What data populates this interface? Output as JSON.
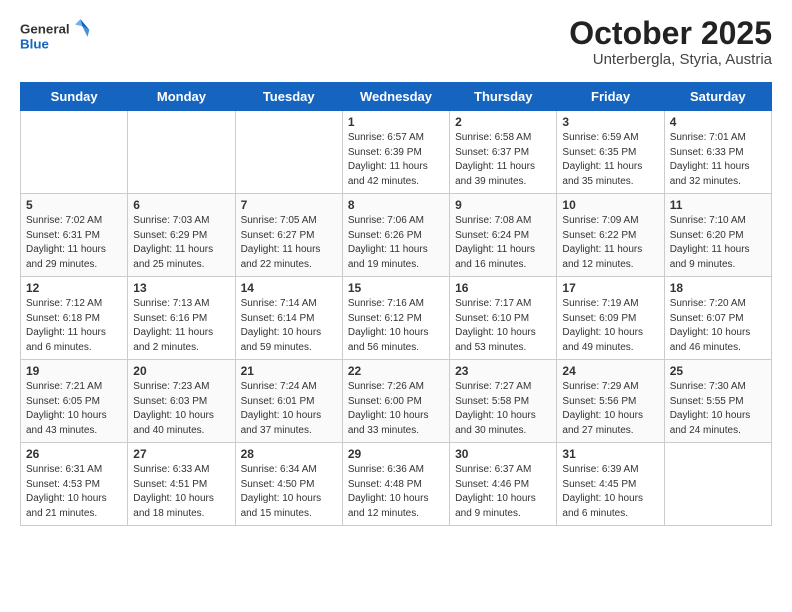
{
  "header": {
    "logo_line1": "General",
    "logo_line2": "Blue",
    "title": "October 2025",
    "subtitle": "Unterbergla, Styria, Austria"
  },
  "days_of_week": [
    "Sunday",
    "Monday",
    "Tuesday",
    "Wednesday",
    "Thursday",
    "Friday",
    "Saturday"
  ],
  "weeks": [
    [
      {
        "day": "",
        "info": ""
      },
      {
        "day": "",
        "info": ""
      },
      {
        "day": "",
        "info": ""
      },
      {
        "day": "1",
        "info": "Sunrise: 6:57 AM\nSunset: 6:39 PM\nDaylight: 11 hours and 42 minutes."
      },
      {
        "day": "2",
        "info": "Sunrise: 6:58 AM\nSunset: 6:37 PM\nDaylight: 11 hours and 39 minutes."
      },
      {
        "day": "3",
        "info": "Sunrise: 6:59 AM\nSunset: 6:35 PM\nDaylight: 11 hours and 35 minutes."
      },
      {
        "day": "4",
        "info": "Sunrise: 7:01 AM\nSunset: 6:33 PM\nDaylight: 11 hours and 32 minutes."
      }
    ],
    [
      {
        "day": "5",
        "info": "Sunrise: 7:02 AM\nSunset: 6:31 PM\nDaylight: 11 hours and 29 minutes."
      },
      {
        "day": "6",
        "info": "Sunrise: 7:03 AM\nSunset: 6:29 PM\nDaylight: 11 hours and 25 minutes."
      },
      {
        "day": "7",
        "info": "Sunrise: 7:05 AM\nSunset: 6:27 PM\nDaylight: 11 hours and 22 minutes."
      },
      {
        "day": "8",
        "info": "Sunrise: 7:06 AM\nSunset: 6:26 PM\nDaylight: 11 hours and 19 minutes."
      },
      {
        "day": "9",
        "info": "Sunrise: 7:08 AM\nSunset: 6:24 PM\nDaylight: 11 hours and 16 minutes."
      },
      {
        "day": "10",
        "info": "Sunrise: 7:09 AM\nSunset: 6:22 PM\nDaylight: 11 hours and 12 minutes."
      },
      {
        "day": "11",
        "info": "Sunrise: 7:10 AM\nSunset: 6:20 PM\nDaylight: 11 hours and 9 minutes."
      }
    ],
    [
      {
        "day": "12",
        "info": "Sunrise: 7:12 AM\nSunset: 6:18 PM\nDaylight: 11 hours and 6 minutes."
      },
      {
        "day": "13",
        "info": "Sunrise: 7:13 AM\nSunset: 6:16 PM\nDaylight: 11 hours and 2 minutes."
      },
      {
        "day": "14",
        "info": "Sunrise: 7:14 AM\nSunset: 6:14 PM\nDaylight: 10 hours and 59 minutes."
      },
      {
        "day": "15",
        "info": "Sunrise: 7:16 AM\nSunset: 6:12 PM\nDaylight: 10 hours and 56 minutes."
      },
      {
        "day": "16",
        "info": "Sunrise: 7:17 AM\nSunset: 6:10 PM\nDaylight: 10 hours and 53 minutes."
      },
      {
        "day": "17",
        "info": "Sunrise: 7:19 AM\nSunset: 6:09 PM\nDaylight: 10 hours and 49 minutes."
      },
      {
        "day": "18",
        "info": "Sunrise: 7:20 AM\nSunset: 6:07 PM\nDaylight: 10 hours and 46 minutes."
      }
    ],
    [
      {
        "day": "19",
        "info": "Sunrise: 7:21 AM\nSunset: 6:05 PM\nDaylight: 10 hours and 43 minutes."
      },
      {
        "day": "20",
        "info": "Sunrise: 7:23 AM\nSunset: 6:03 PM\nDaylight: 10 hours and 40 minutes."
      },
      {
        "day": "21",
        "info": "Sunrise: 7:24 AM\nSunset: 6:01 PM\nDaylight: 10 hours and 37 minutes."
      },
      {
        "day": "22",
        "info": "Sunrise: 7:26 AM\nSunset: 6:00 PM\nDaylight: 10 hours and 33 minutes."
      },
      {
        "day": "23",
        "info": "Sunrise: 7:27 AM\nSunset: 5:58 PM\nDaylight: 10 hours and 30 minutes."
      },
      {
        "day": "24",
        "info": "Sunrise: 7:29 AM\nSunset: 5:56 PM\nDaylight: 10 hours and 27 minutes."
      },
      {
        "day": "25",
        "info": "Sunrise: 7:30 AM\nSunset: 5:55 PM\nDaylight: 10 hours and 24 minutes."
      }
    ],
    [
      {
        "day": "26",
        "info": "Sunrise: 6:31 AM\nSunset: 4:53 PM\nDaylight: 10 hours and 21 minutes."
      },
      {
        "day": "27",
        "info": "Sunrise: 6:33 AM\nSunset: 4:51 PM\nDaylight: 10 hours and 18 minutes."
      },
      {
        "day": "28",
        "info": "Sunrise: 6:34 AM\nSunset: 4:50 PM\nDaylight: 10 hours and 15 minutes."
      },
      {
        "day": "29",
        "info": "Sunrise: 6:36 AM\nSunset: 4:48 PM\nDaylight: 10 hours and 12 minutes."
      },
      {
        "day": "30",
        "info": "Sunrise: 6:37 AM\nSunset: 4:46 PM\nDaylight: 10 hours and 9 minutes."
      },
      {
        "day": "31",
        "info": "Sunrise: 6:39 AM\nSunset: 4:45 PM\nDaylight: 10 hours and 6 minutes."
      },
      {
        "day": "",
        "info": ""
      }
    ]
  ]
}
